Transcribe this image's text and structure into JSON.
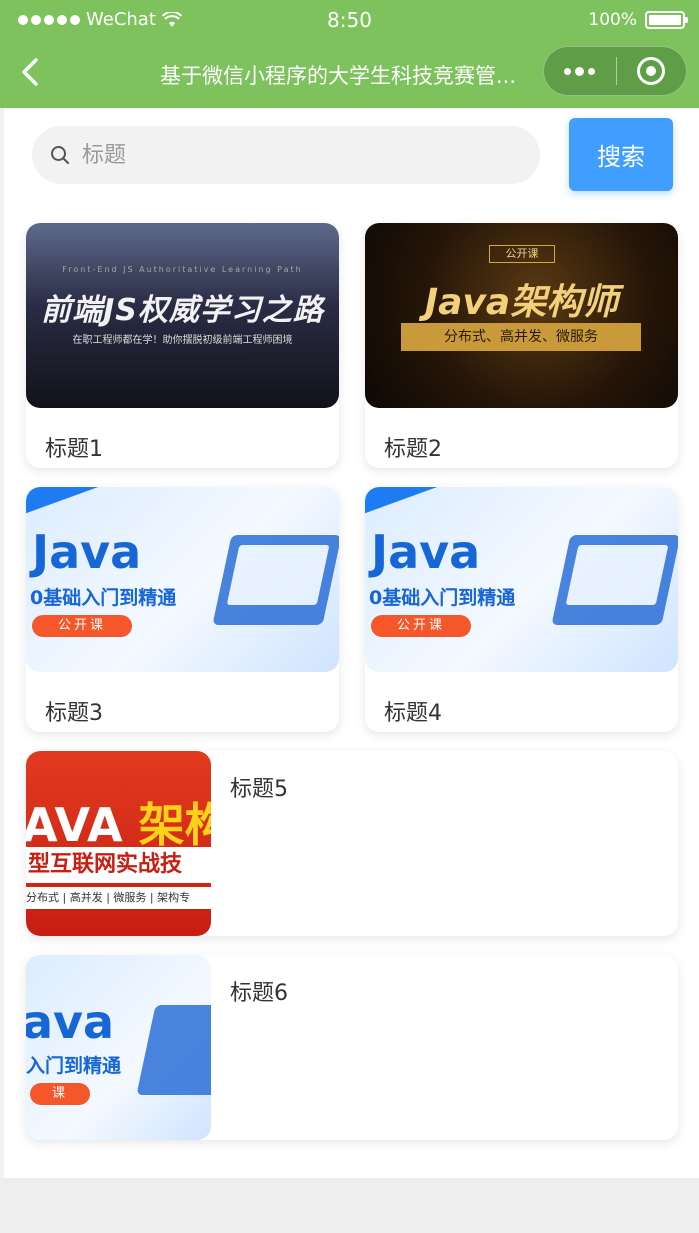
{
  "status_bar": {
    "carrier": "WeChat",
    "time": "8:50",
    "battery": "100%"
  },
  "nav": {
    "title": "基于微信小程序的大学生科技竞赛管..."
  },
  "search": {
    "placeholder": "标题",
    "value": "",
    "button_label": "搜索"
  },
  "colors": {
    "header_bg": "#7dc25d",
    "search_button": "#409eff"
  },
  "grid_items": [
    {
      "title": "标题1",
      "banner": {
        "top": "Front-End JS Authoritative Learning Path",
        "headline": "前端JS权威学习之路",
        "sub": "在职工程师都在学！助你摆脱初级前端工程师困境"
      }
    },
    {
      "title": "标题2",
      "banner": {
        "tag": "公开课",
        "headline": "Java架构师",
        "sub": "分布式、高并发、微服务"
      }
    },
    {
      "title": "标题3",
      "banner": {
        "headline": "Java",
        "sub": "0基础入门到精通",
        "pill": "公开课"
      }
    },
    {
      "title": "标题4",
      "banner": {
        "headline": "Java",
        "sub": "0基础入门到精通",
        "pill": "公开课"
      }
    }
  ],
  "list_items": [
    {
      "title": "标题5",
      "banner": {
        "headline_a": "AVA",
        "headline_b": "架构",
        "band": "型互联网实战技",
        "small": "分布式 | 高并发 | 微服务 | 架构专"
      }
    },
    {
      "title": "标题6",
      "banner": {
        "headline": "ava",
        "sub": "入门到精通",
        "pill": "课"
      }
    }
  ]
}
